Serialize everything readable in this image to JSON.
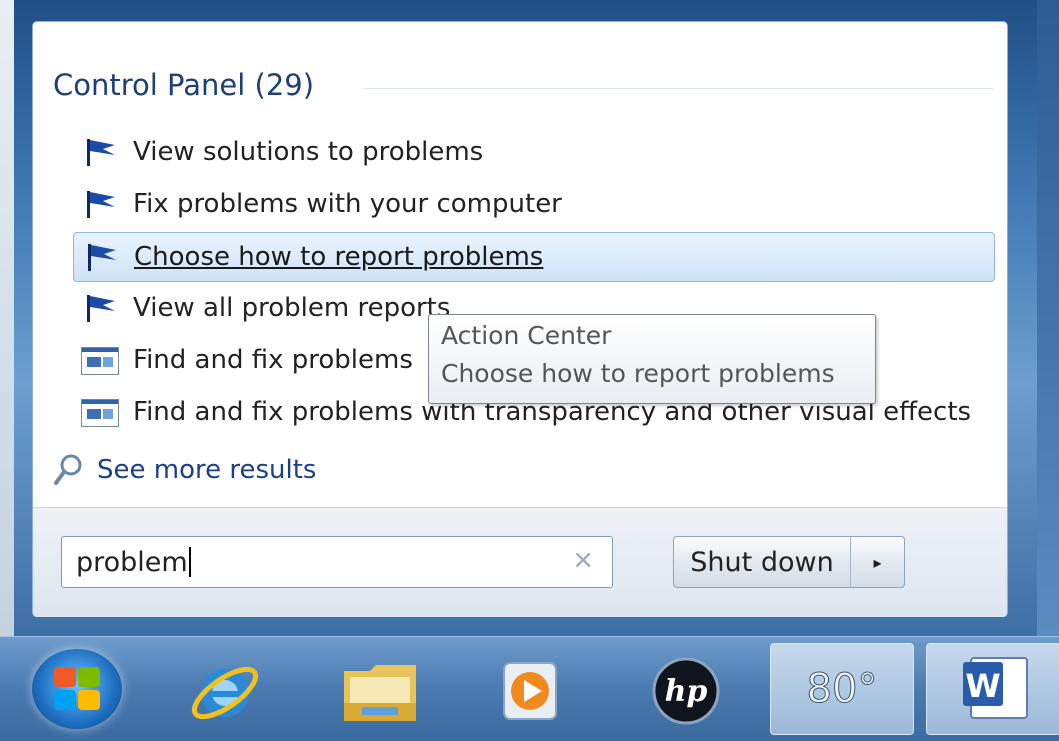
{
  "start_menu": {
    "section_title": "Control Panel (29)",
    "results": [
      {
        "label": "View solutions to problems",
        "icon": "flag-icon"
      },
      {
        "label": "Fix problems with your computer",
        "icon": "flag-icon"
      },
      {
        "label": "Choose how to report problems",
        "icon": "flag-icon",
        "highlighted": true
      },
      {
        "label": "View all problem reports",
        "icon": "flag-icon"
      },
      {
        "label": "Find and fix problems",
        "icon": "window-icon"
      },
      {
        "label": "Find and fix problems with transparency and other visual effects",
        "icon": "window-icon"
      }
    ],
    "see_more": "See more results",
    "tooltip": {
      "line1": "Action Center",
      "line2": "Choose how to report problems"
    },
    "search": {
      "value": "problem",
      "clear_symbol": "×"
    },
    "shutdown_label": "Shut down",
    "shutdown_arrow": "▸"
  },
  "taskbar": {
    "items": [
      "start-orb",
      "internet-explorer-icon",
      "windows-explorer-icon",
      "media-player-icon",
      "hp-icon"
    ],
    "weather_temp": "80°",
    "word_letter": "W"
  },
  "colors": {
    "section_title": "#1e3f78",
    "link": "#1b3f8a",
    "highlight_bg": "#cfe2f7"
  }
}
